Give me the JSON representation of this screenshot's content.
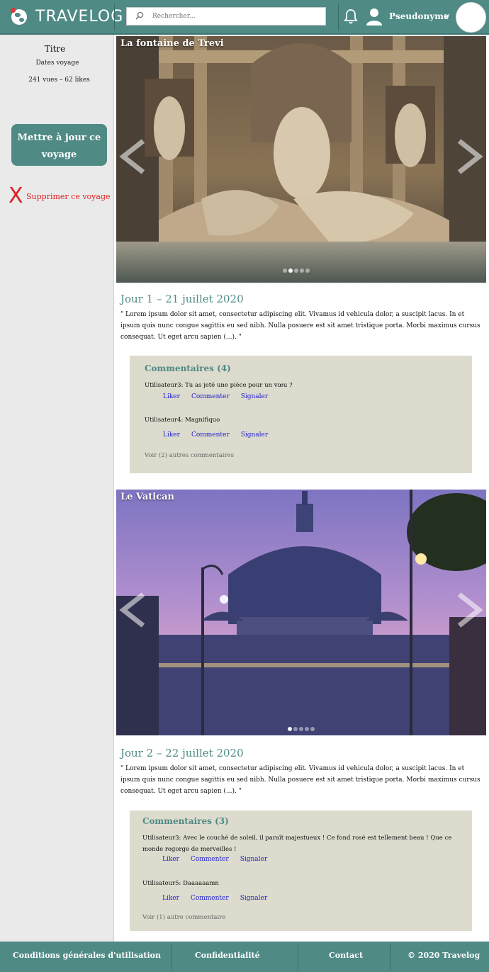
{
  "header": {
    "logo_text": "TRAVELOG",
    "search_placeholder": "Rechercher...",
    "username": "Pseudonyme",
    "chevron": "v"
  },
  "sidebar": {
    "title": "Titre",
    "dates": "Dates voyage",
    "stats": "241 vues – 62 likes",
    "update_button": "Mettre à jour ce voyage",
    "delete_icon": "X",
    "delete_label": "Supprimer ce voyage"
  },
  "days": [
    {
      "photo_title": "La fontaine de Trevi",
      "title": "Jour 1 – 21 juillet 2020",
      "text": "\" Lorem ipsum dolor sit amet, consectetur adipiscing elit. Vivamus id vehicula dolor, a suscipit lacus. In et ipsum quis nunc congue sagittis eu sed nibh. Nulla posuere est sit amet tristique porta. Morbi maximus cursus consequat. Ut eget arcu sapien (...). \"",
      "comments_heading": "Commentaires (4)",
      "comments": [
        {
          "text": "Utilisateur3: Tu as jeté une pièce pour un vœu ?"
        },
        {
          "text": "Utilisateur4: Magnifiquo"
        }
      ],
      "see_more": "Voir (2) autres commentaires",
      "carousel_dots": 5,
      "active_dot": 2
    },
    {
      "photo_title": "Le Vatican",
      "title": "Jour 2 – 22 juillet 2020",
      "text": "\" Lorem ipsum dolor sit amet, consectetur adipiscing elit. Vivamus id vehicula dolor, a suscipit lacus. In et ipsum quis nunc congue sagittis eu sed nibh. Nulla posuere est sit amet tristique porta. Morbi maximus cursus consequat. Ut eget arcu sapien (...). \"",
      "comments_heading": "Commentaires (3)",
      "comments": [
        {
          "text": "Utilisateur3: Avec le couché de soleil, il paraît majestueux ! Ce fond rosé est tellement beau ! Que ce monde regorge de merveilles !"
        },
        {
          "text": "Utilisateur5: Daaaaaamn"
        }
      ],
      "see_more": "Voir (1) autre commentaire",
      "carousel_dots": 5,
      "active_dot": 1
    }
  ],
  "comment_actions": {
    "like": "Liker",
    "comment": "Commenter",
    "report": "Signaler"
  },
  "footer": {
    "terms": "Conditions générales d'utilisation",
    "privacy": "Confidentialité",
    "contact": "Contact",
    "copyright": "©  2020 Travelog"
  }
}
